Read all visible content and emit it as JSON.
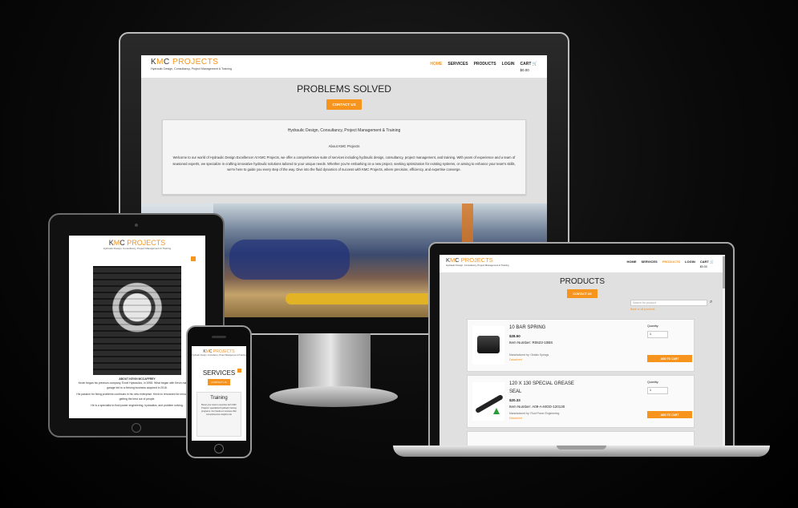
{
  "brand": {
    "logo_k": "K",
    "logo_m": "M",
    "logo_c": "C",
    "logo_rest": " PROJECTS",
    "tagline": "Hydraulic Design, Consultancy, Project Management & Training",
    "accent": "#f7941d"
  },
  "nav": {
    "home": "HOME",
    "services": "SERVICES",
    "products": "PRODUCTS",
    "login": "LOGIN",
    "cart": "CART",
    "cart_icon": "cart-icon",
    "cart_amount": "$0.00"
  },
  "desktop": {
    "hero_title": "PROBLEMS SOLVED",
    "contact_button": "CONTACT US",
    "card_heading": "Hydraulic Design, Consultancy, Project Management & Training",
    "card_subheading": "About KMC Projects",
    "card_paragraph": "Welcome to our world of Hydraulic Design Excellence! At KMC Projects, we offer a comprehensive suite of services including hydraulic design, consultancy, project management, and training. With years of experience and a team of seasoned experts, we specialize in crafting innovative hydraulic solutions tailored to your unique needs. Whether you're embarking on a new project, seeking optimization for existing systems, or aiming to enhance your team's skills, we're here to guide you every step of the way. Dive into the fluid dynamics of success with KMC Projects, where precision, efficiency, and expertise converge."
  },
  "tablet": {
    "about_heading": "ABOUT KEVIN MCCAFFREY",
    "about_p1": "Kevin began his previous company, Excel Hydraulics, in 1998. What began with Kevin making the garage led to a thriving business acquired in 2016.",
    "about_p2": "His passion for fixing problems continues in his new enterprise. Kevin is renowned for innovation and getting the best out of people.",
    "about_p3": "He is a specialist in fluid power engineering, hydraulics, and problem solving."
  },
  "phone": {
    "title": "SERVICES",
    "contact_button": "CONTACT US",
    "card_heading": "Training",
    "card_text": "Boost your team's expertise with KMC Projects' specialized hydraulic training programs. Our hands-on courses offer comprehensive insights into"
  },
  "laptop": {
    "title": "PRODUCTS",
    "contact_button": "CONTACT US",
    "search_placeholder": "Search for product",
    "search_icon": "search-icon",
    "back_link": "Back to all products",
    "products": [
      {
        "name": "10 BAR SPRING",
        "price": "$28.50",
        "item_number": "Item Number: R0623-10BS",
        "manufacturer": "Manufactured by: Giraldo Springs",
        "datasheet": "Datasheet",
        "quantity_label": "Quantity:",
        "quantity_value": "1",
        "add_to_cart": "ADD TO CART"
      },
      {
        "name": "120 X 130 SPECIAL GREASE SEAL",
        "price": "$20.33",
        "item_number": "Item Number: A09-A-MOD-120130",
        "manufacturer": "Manufactured by: Fluid Power Engineering",
        "datasheet": "Datasheet",
        "quantity_label": "Quantity:",
        "quantity_value": "1",
        "add_to_cart": "ADD TO CART"
      }
    ]
  }
}
